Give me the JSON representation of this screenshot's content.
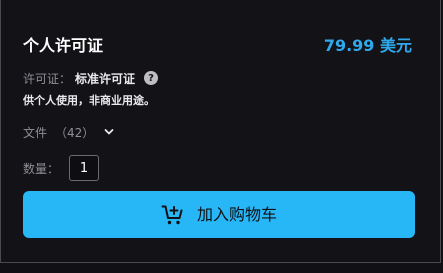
{
  "product": {
    "title": "个人许可证",
    "price": "79.99 美元"
  },
  "license": {
    "label": "许可证：",
    "value": "标准许可证",
    "help_icon": "?",
    "description": "供个人使用，非商业用途。"
  },
  "files": {
    "label": "文件",
    "count": "（42）"
  },
  "quantity": {
    "label": "数量：",
    "value": "1"
  },
  "cart_button": {
    "label": "加入购物车"
  },
  "colors": {
    "accent": "#27b6f6",
    "price": "#2fa9ec",
    "background": "#131217"
  }
}
